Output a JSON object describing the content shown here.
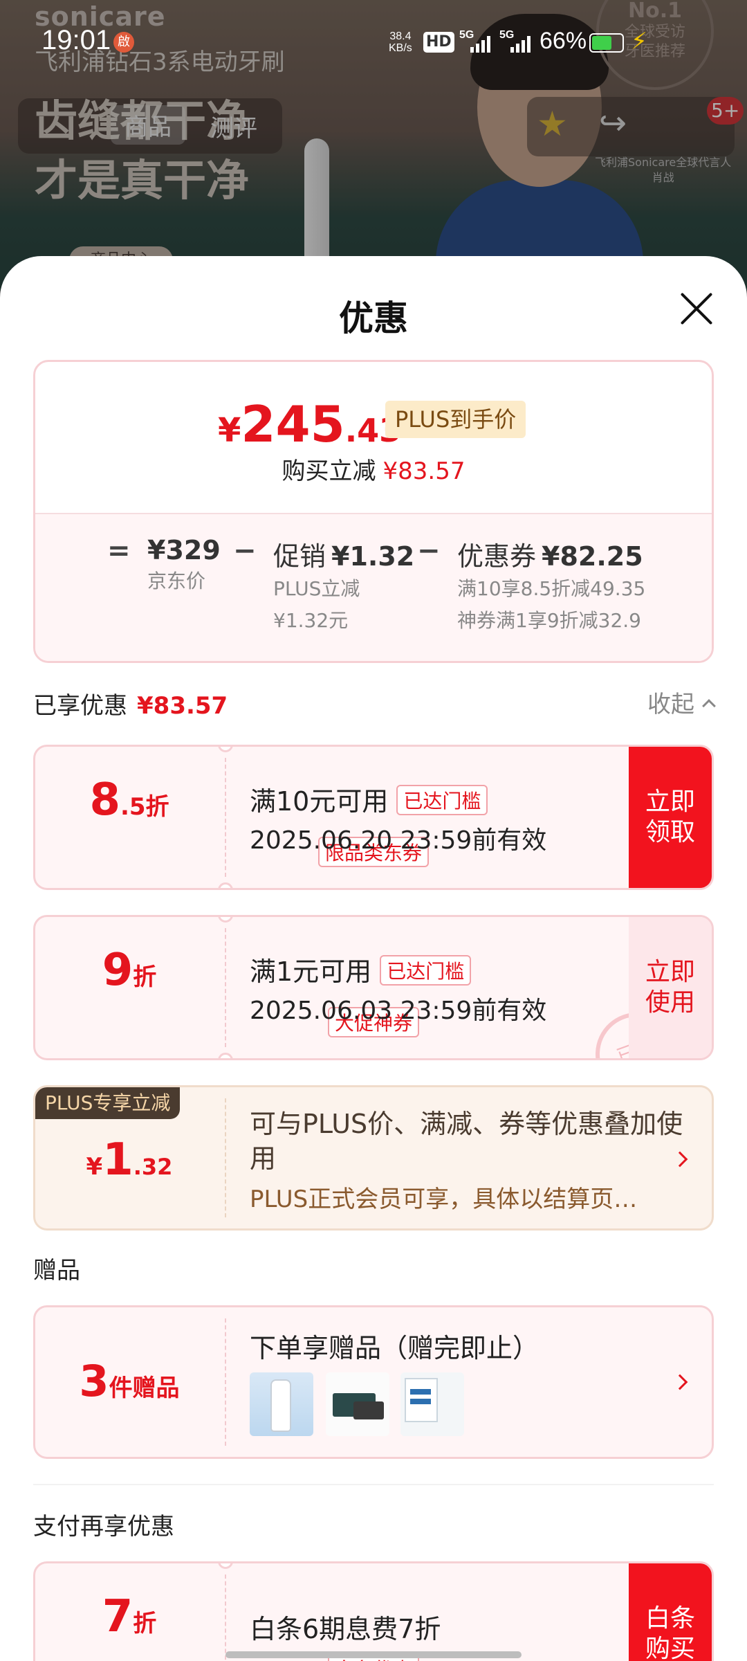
{
  "status_bar": {
    "time": "19:01",
    "app_badge": "啟",
    "net_speed_value": "38.4",
    "net_speed_unit": "KB/s",
    "hd": "HD",
    "sim1": "5G",
    "sim2": "5G",
    "battery_pct": "66%",
    "battery_level": 0.66,
    "battery_color": "#3fcf4a"
  },
  "backdrop": {
    "brand": "sonicare",
    "product_line": "飞利浦钻石3系电动牙刷",
    "slogan_line1": "齿缝都干净",
    "slogan_line2": "才是真干净",
    "tab_product": "商品",
    "tab_review": "测评",
    "badge_top": "No.1",
    "badge_line1": "全球受访",
    "badge_line2": "牙医推荐",
    "endorser_line1": "飞利浦Sonicare全球代言人",
    "endorser_line2": "肖战",
    "chip": "商品中心",
    "cart_count": "5+"
  },
  "sheet": {
    "title": "优惠",
    "price": {
      "currency": "¥",
      "integer": "245",
      "decimal": ".43",
      "tag": "PLUS到手价",
      "reduce_label": "购买立减",
      "reduce_amount": "¥83.57"
    },
    "breakdown": {
      "eq": "=",
      "minus": "−",
      "jd_price": "¥329",
      "jd_price_label": "京东价",
      "promo_label": "促销",
      "promo_value": "¥1.32",
      "promo_note1": "PLUS立减",
      "promo_note2": "¥1.32元",
      "coupon_label": "优惠券",
      "coupon_value": "¥82.25",
      "coupon_note1": "满10享8.5折减49.35",
      "coupon_note2": "神券满1享9折减32.9"
    },
    "enjoyed": {
      "label": "已享优惠",
      "amount": "¥83.57",
      "collapse": "收起"
    },
    "coupons": [
      {
        "discount_big": "8",
        "discount_small": ".5折",
        "type": "限品类东券",
        "title": "满10元可用",
        "badge": "已达门槛",
        "valid": "2025.06.20 23:59前有效",
        "action_line1": "立即",
        "action_line2": "领取"
      },
      {
        "discount_big": "9",
        "discount_small": "折",
        "type": "大促神券",
        "title": "满1元可用",
        "badge": "已达门槛",
        "valid": "2025.06.03 23:59前有效",
        "action_line1": "立即",
        "action_line2": "使用",
        "stamp": "已领"
      }
    ],
    "plus": {
      "tag": "PLUS专享立减",
      "currency": "¥",
      "big": "1",
      "small": ".32",
      "desc": "可与PLUS价、满减、券等优惠叠加使用",
      "note": "PLUS正式会员可享，具体以结算页为准"
    },
    "gifts": {
      "section": "赠品",
      "count_big": "3",
      "count_small": "件赠品",
      "title": "下单享赠品（赠完即止）",
      "images": [
        "cleanser-tube-image",
        "gift-box-image",
        "care-card-image"
      ]
    },
    "pay": {
      "section": "支付再享优惠",
      "discount_big": "7",
      "discount_small": "折",
      "type": "白条优惠",
      "title": "白条6期息费7折",
      "action_line1": "白条",
      "action_line2": "购买"
    }
  }
}
